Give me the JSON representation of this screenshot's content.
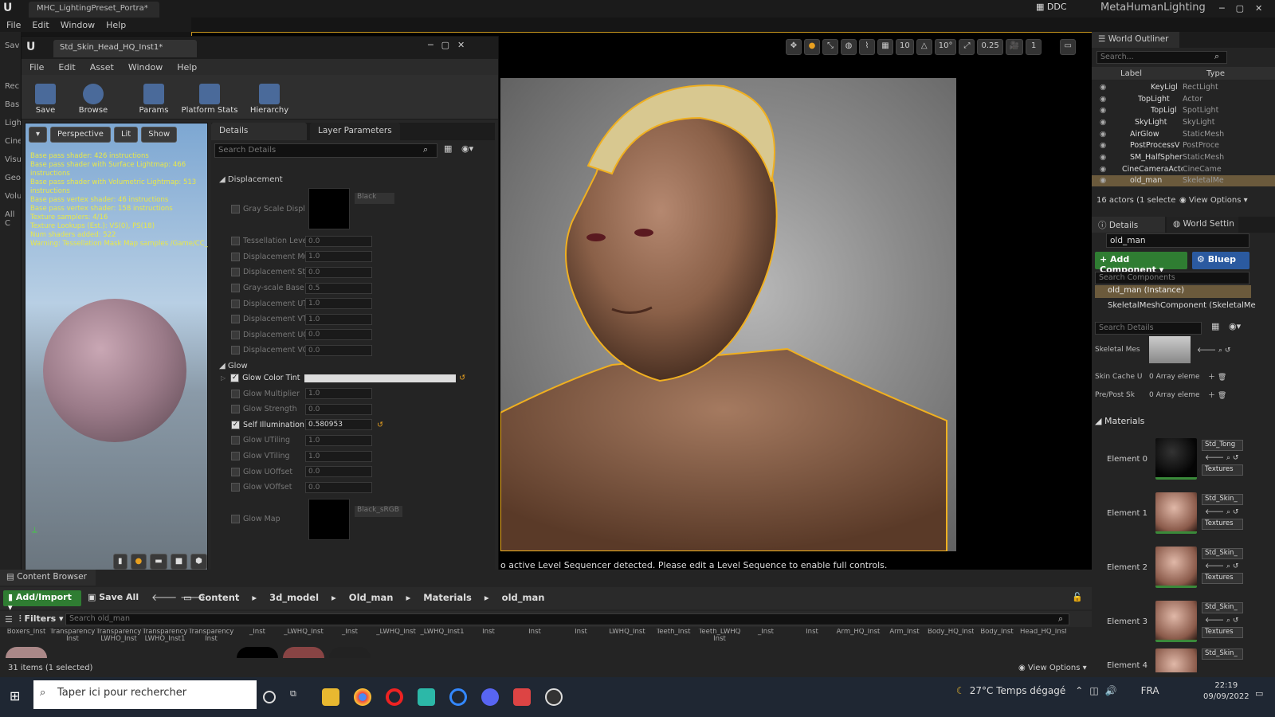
{
  "app": {
    "project_tab": "MHC_LightingPreset_Portra*",
    "window_title": "MetaHumanLighting",
    "ddc": "DDC",
    "menu": [
      "File",
      "Edit",
      "Window",
      "Help"
    ]
  },
  "left_strip": [
    "Sav",
    "Rec",
    "Bas",
    "Ligh",
    "Cine",
    "Visu",
    "Geo",
    "Volu",
    "All C"
  ],
  "material_editor": {
    "tab": "Std_Skin_Head_HQ_Inst1*",
    "menu": [
      "File",
      "Edit",
      "Asset",
      "Window",
      "Help"
    ],
    "tools": [
      "Save",
      "Browse",
      "Params",
      "Platform Stats",
      "Hierarchy"
    ],
    "preview": {
      "buttons": [
        "Perspective",
        "Lit",
        "Show"
      ],
      "stats": [
        "Base pass shader: 426 instructions",
        "Base pass shader with Surface Lightmap: 466 instructions",
        "Base pass shader with Volumetric Lightmap: 513 instructions",
        "Base pass vertex shader: 46 instructions",
        "Base pass vertex shader: 158 instructions",
        "Texture samplers: 4/16",
        "Texture Lookups (Est.): VS(0), PS(18)",
        "Num shaders added: 522",
        "Warning: Tessellation Mask Map samples /Game/CC_"
      ]
    },
    "details_tabs": [
      "Details",
      "Layer Parameters"
    ],
    "search_placeholder": "Search Details",
    "displacement": {
      "header": "Displacement",
      "gray_label": "Gray Scale Displac",
      "gray_tex": "Black",
      "props": [
        {
          "label": "Tessellation Level",
          "value": "0.0"
        },
        {
          "label": "Displacement Mult",
          "value": "1.0"
        },
        {
          "label": "Displacement Stren",
          "value": "0.0"
        },
        {
          "label": "Gray-scale Base Va",
          "value": "0.5"
        },
        {
          "label": "Displacement UTili",
          "value": "1.0"
        },
        {
          "label": "Displacement VTili",
          "value": "1.0"
        },
        {
          "label": "Displacement UOff",
          "value": "0.0"
        },
        {
          "label": "Displacement VOff",
          "value": "0.0"
        }
      ]
    },
    "glow": {
      "header": "Glow",
      "tint_label": "Glow Color Tint",
      "props": [
        {
          "label": "Glow Multiplier",
          "value": "1.0",
          "on": false
        },
        {
          "label": "Glow Strength",
          "value": "0.0",
          "on": false
        },
        {
          "label": "Self Illumination",
          "value": "0.580953",
          "on": true
        },
        {
          "label": "Glow UTiling",
          "value": "1.0",
          "on": false
        },
        {
          "label": "Glow VTiling",
          "value": "1.0",
          "on": false
        },
        {
          "label": "Glow UOffset",
          "value": "0.0",
          "on": false
        },
        {
          "label": "Glow VOffset",
          "value": "0.0",
          "on": false
        }
      ],
      "map_label": "Glow Map",
      "map_tex": "Black_sRGB"
    }
  },
  "viewport": {
    "status": "o active Level Sequencer detected. Please edit a Level Sequence to enable full controls.",
    "toolbar": [
      "10",
      "10°",
      "0.25",
      "1"
    ]
  },
  "outliner": {
    "tab": "World Outliner",
    "search_placeholder": "Search...",
    "col_label": "Label",
    "col_type": "Type",
    "rows": [
      {
        "label": "KeyLigl",
        "type": "RectLight",
        "sel": false
      },
      {
        "label": "TopLight",
        "type": "Actor",
        "sel": false
      },
      {
        "label": "TopLigl",
        "type": "SpotLight",
        "sel": false
      },
      {
        "label": "SkyLight",
        "type": "SkyLight",
        "sel": false
      },
      {
        "label": "AirGlow",
        "type": "StaticMesh",
        "sel": false
      },
      {
        "label": "PostProcessV",
        "type": "PostProce",
        "sel": false
      },
      {
        "label": "SM_HalfSpher",
        "type": "StaticMesh",
        "sel": false
      },
      {
        "label": "CineCameraActo",
        "type": "CineCame",
        "sel": false
      },
      {
        "label": "old_man",
        "type": "SkeletalMe",
        "sel": true
      }
    ],
    "footer": "16 actors (1 selecte",
    "view_options": "View Options"
  },
  "details": {
    "tabs": [
      "Details",
      "World Settin"
    ],
    "name": "old_man",
    "add_component": "+ Add Component",
    "blueprint": "Bluep",
    "comp_search": "Search Components",
    "instance": "old_man (Instance)",
    "skeletal": "SkeletalMeshComponent (SkeletalMe",
    "search": "Search Details",
    "kv": [
      {
        "k": "Skeletal Mes",
        "v": ""
      },
      {
        "k": "Skin Cache U",
        "v": "0 Array eleme"
      },
      {
        "k": "Pre/Post Sk",
        "v": "0 Array eleme"
      }
    ],
    "materials_header": "Materials",
    "elements": [
      {
        "name": "Element 0",
        "mat": "Std_Tong",
        "dark": true
      },
      {
        "name": "Element 1",
        "mat": "Std_Skin_",
        "dark": false
      },
      {
        "name": "Element 2",
        "mat": "Std_Skin_",
        "dark": false
      },
      {
        "name": "Element 3",
        "mat": "Std_Skin_",
        "dark": false
      },
      {
        "name": "Element 4",
        "mat": "Std_Skin_",
        "dark": false
      }
    ],
    "textures": "Textures"
  },
  "content_browser": {
    "tab": "Content Browser",
    "add_import": "Add/Import",
    "save_all": "Save All",
    "crumbs": [
      "Content",
      "3d_model",
      "Old_man",
      "Materials",
      "old_man"
    ],
    "filters": "Filters",
    "search_placeholder": "Search old_man",
    "assets": [
      "Boxers_Inst",
      "Transparency Inst",
      "Transparency LWHO_Inst",
      "Transparency LWHO_Inst1",
      "Transparency Inst",
      "_Inst",
      "_LWHQ_Inst",
      "_Inst",
      "_LWHQ_Inst",
      "_LWHQ_Inst1",
      "Inst",
      "Inst",
      "Inst",
      "LWHQ_Inst",
      "Teeth_Inst",
      "Teeth_LWHQ Inst",
      "_Inst",
      "Inst",
      "Arm_HQ_Inst",
      "Arm_Inst",
      "Body_HQ_Inst",
      "Body_Inst",
      "Head_HQ_Inst"
    ],
    "footer": "31 items (1 selected)",
    "view_options": "View Options"
  },
  "taskbar": {
    "search": "Taper ici pour rechercher",
    "weather": "27°C  Temps dégagé",
    "lang": "FRA",
    "time": "22:19",
    "date": "09/09/2022"
  }
}
